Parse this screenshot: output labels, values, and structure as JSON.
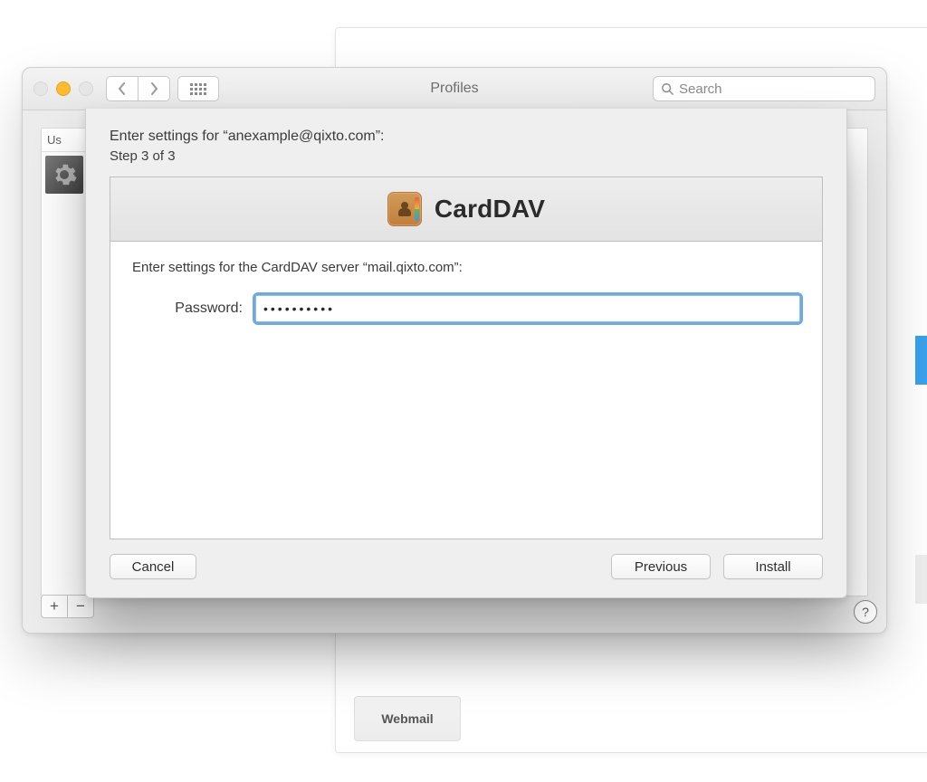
{
  "window": {
    "title": "Profiles",
    "search_placeholder": "Search",
    "sidebar_label": "Us",
    "help": "?"
  },
  "sheet": {
    "heading": "Enter settings for “anexample@qixto.com”:",
    "step": "Step 3 of 3",
    "panel_title": "CardDAV",
    "server_line": "Enter settings for the CardDAV server “mail.qixto.com”:",
    "password_label": "Password:",
    "password_value": "••••••••••",
    "buttons": {
      "cancel": "Cancel",
      "previous": "Previous",
      "install": "Install"
    }
  },
  "back": {
    "webmail": "Webmail"
  },
  "icons": {
    "add": "+",
    "remove": "−"
  }
}
